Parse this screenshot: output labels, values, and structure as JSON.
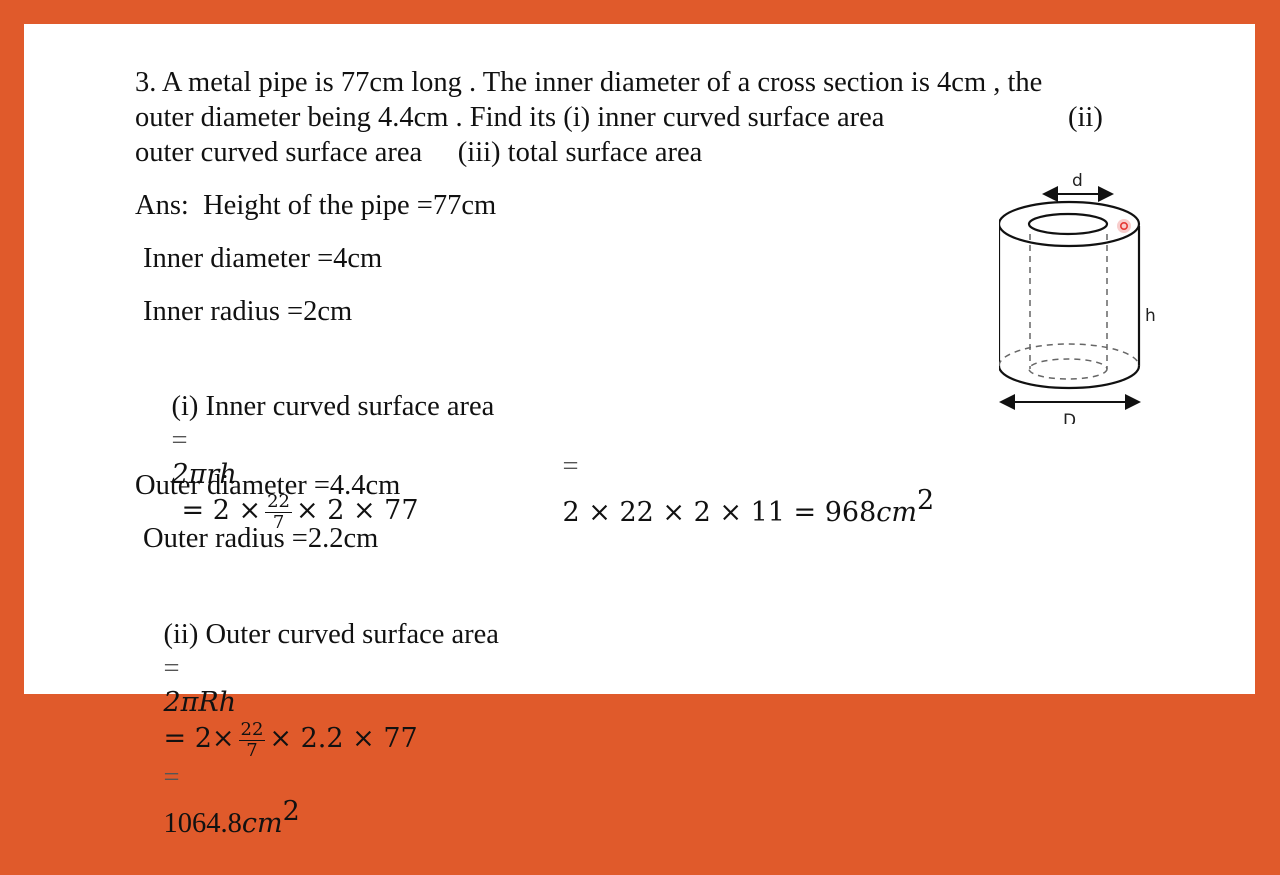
{
  "question": {
    "line1": "3. A metal pipe is 77cm long . The inner diameter of a cross section is 4cm , the",
    "line2a": "outer diameter being 4.4cm . Find its (i) inner curved surface area",
    "line2b": "(ii)",
    "line3": "outer curved surface area     (iii) total surface area"
  },
  "answer": {
    "height": "Ans:  Height of the pipe =77cm",
    "inner_diameter": "Inner diameter =4cm",
    "inner_radius": "Inner radius =2cm",
    "inner_csa_label": "(i) Inner curved surface area",
    "inner_csa_formula": "2πrh",
    "inner_csa_expr_a": "= 2 ×",
    "inner_csa_frac_num": "22",
    "inner_csa_frac_den": "7",
    "inner_csa_expr_b": "× 2 × 77",
    "inner_csa_step2": "2 × 22 × 2 × 11 = 968",
    "inner_csa_unit": "cm",
    "unit_power": "2",
    "outer_diameter": "Outer diameter =4.4cm",
    "outer_radius": "Outer radius =2.2cm",
    "outer_csa_label": "(ii) Outer curved surface area",
    "outer_csa_formula": "2πRh",
    "outer_csa_expr_a": "= 2×",
    "outer_csa_frac_num": "22",
    "outer_csa_frac_den": "7",
    "outer_csa_expr_b": "× 2.2 × 77",
    "outer_csa_result": "1064.8",
    "outer_csa_unit": "cm",
    "equals": "="
  },
  "figure": {
    "label_d": "d",
    "label_h": "h",
    "label_D": "D"
  },
  "colors": {
    "frame": "#e05a2b",
    "background": "#ffffff",
    "pointer": "#e53935"
  }
}
